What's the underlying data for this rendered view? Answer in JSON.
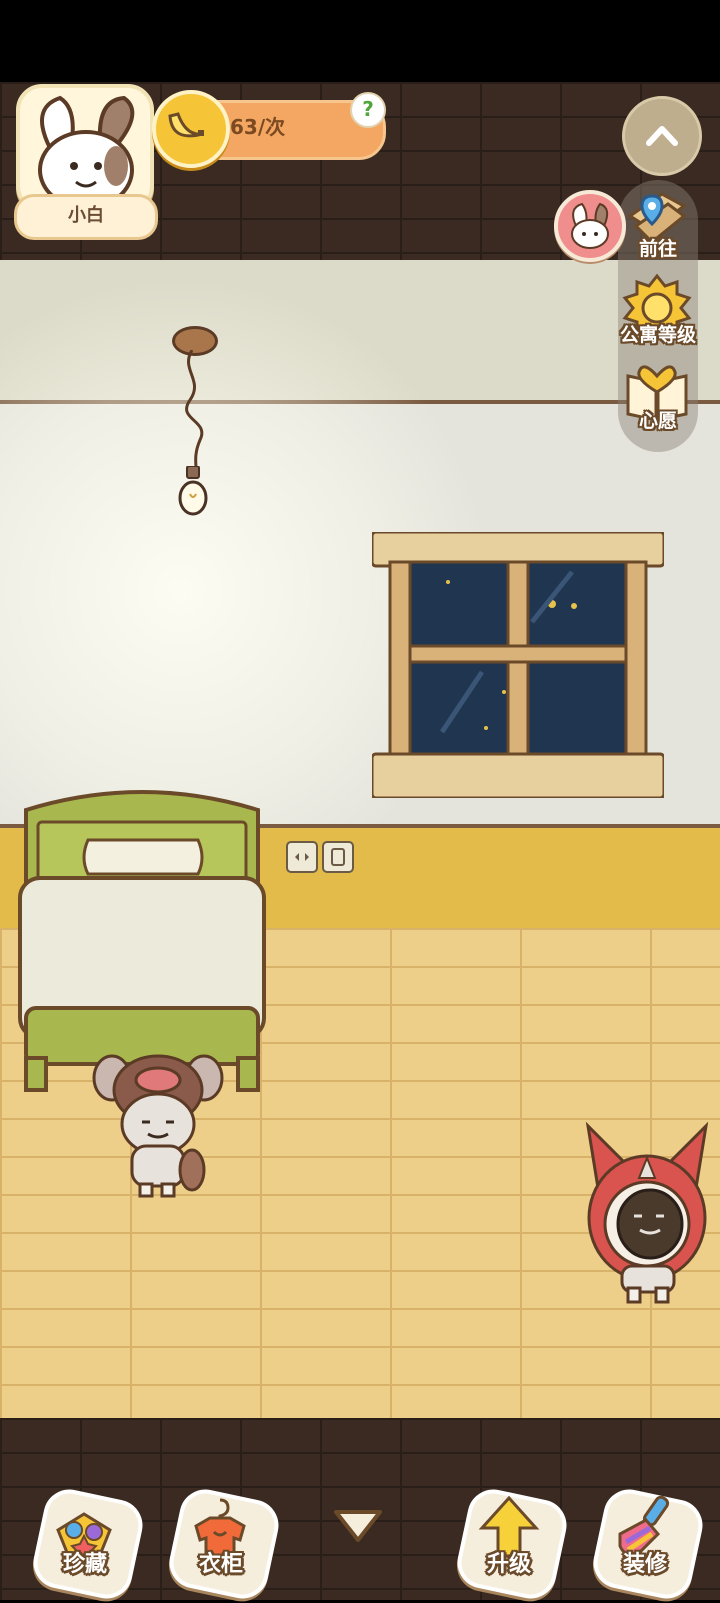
{
  "player": {
    "name": "小白"
  },
  "resource": {
    "rate_text": "63/次",
    "help_label": "?"
  },
  "side_menu": {
    "items": [
      {
        "label": "前往",
        "icon": "map-pin-icon"
      },
      {
        "label": "公寓等级",
        "icon": "apartment-level-icon"
      },
      {
        "label": "心愿",
        "icon": "wish-book-icon"
      }
    ]
  },
  "bottom_bar": {
    "items": [
      {
        "label": "珍藏",
        "icon": "treasure-icon"
      },
      {
        "label": "衣柜",
        "icon": "wardrobe-icon"
      },
      {
        "label": "升级",
        "icon": "upgrade-arrow-icon"
      },
      {
        "label": "装修",
        "icon": "paint-brush-icon"
      }
    ]
  },
  "colors": {
    "accent_orange": "#f4a763",
    "banana_yellow": "#f6c437",
    "label_outline": "#6b4a2a"
  }
}
